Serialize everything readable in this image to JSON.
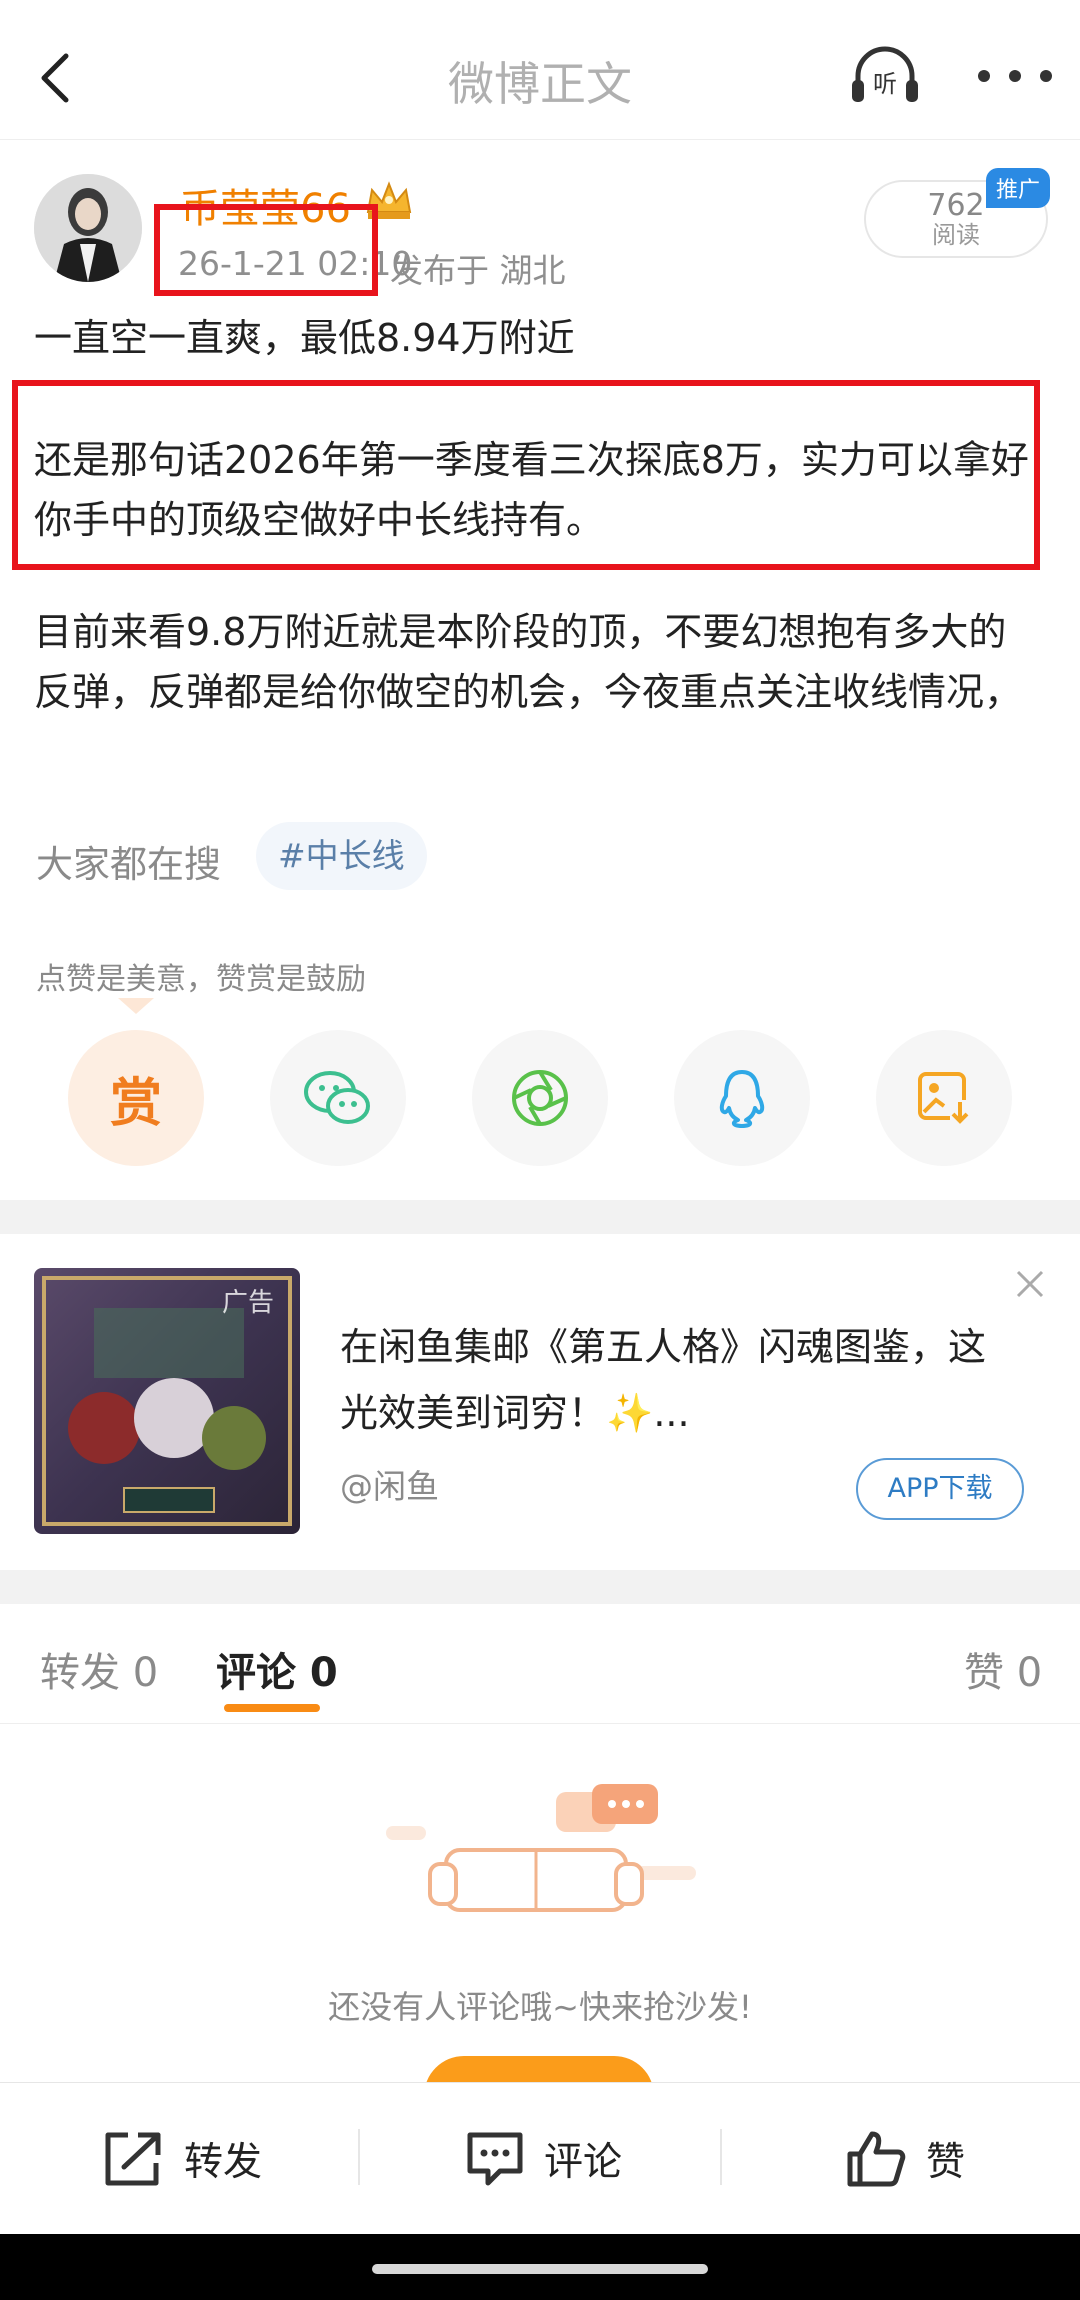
{
  "header": {
    "title": "微博正文",
    "listen_label": "听",
    "back_icon": "back-arrow-icon",
    "more_icon": "more-dots-icon"
  },
  "post": {
    "author": "币莹莹66",
    "time": "26-1-21 02:10",
    "location": "发布于 湖北",
    "read_count": "762",
    "read_label": "阅读",
    "promo_badge": "推广",
    "paragraphs": [
      "一直空一直爽，最低8.94万附近",
      "还是那句话2026年第一季度看三次探底8万，实力可以拿好你手中的顶级空做好中长线持有。",
      "目前来看9.8万附近就是本阶段的顶，不要幻想抱有多大的反弹，反弹都是给你做空的机会，今夜重点关注收线情况，"
    ]
  },
  "search": {
    "label": "大家都在搜",
    "tag": "#中长线"
  },
  "reward": {
    "tip": "点赞是美意，赞赏是鼓励",
    "reward_char": "赏"
  },
  "share": {
    "icons": [
      "reward-icon",
      "wechat-icon",
      "moments-icon",
      "qq-icon",
      "save-image-icon"
    ]
  },
  "ad": {
    "tag": "广告",
    "text": "在闲鱼集邮《第五人格》闪魂图鉴，这光效美到词穷！✨...",
    "source": "@闲鱼",
    "button": "APP下载"
  },
  "tabs": {
    "repost": "转发 0",
    "comment": "评论 0",
    "like": "赞 0"
  },
  "empty": {
    "text": "还没有人评论哦~快来抢沙发!"
  },
  "bottom_bar": {
    "repost": "转发",
    "comment": "评论",
    "like": "赞"
  },
  "colors": {
    "accent": "#f98b14",
    "nickname": "#f08000",
    "annotation_red": "#e8141c",
    "link_blue": "#2e7cc4"
  }
}
